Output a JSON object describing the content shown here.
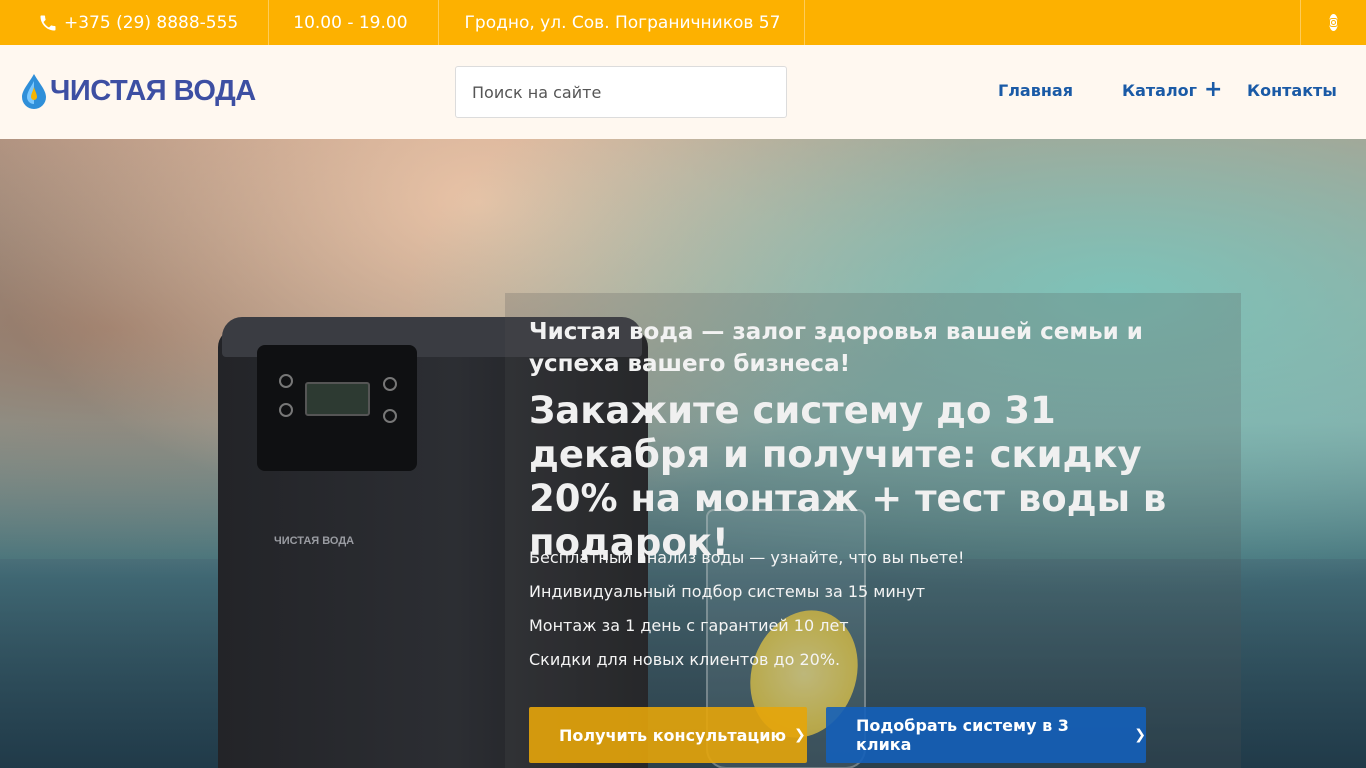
{
  "topbar": {
    "phone": "+375 (29) 8888-555",
    "hours": "10.00 - 19.00",
    "address": "Гродно, ул. Сов. Пограничников 57",
    "social_icon": "instagram-icon"
  },
  "header": {
    "logo_text": "ЧИСТАЯ ВОДА",
    "search_placeholder": "Поиск на сайте",
    "nav": {
      "home": "Главная",
      "catalog": "Каталог",
      "catalog_expand": "+",
      "contacts": "Контакты"
    }
  },
  "hero": {
    "subtitle": "Чистая вода — залог здоровья вашей семьи и успеха вашего бизнеса!",
    "title": "Закажите систему до 31 декабря и получите: скидку 20% на монтаж + тест воды в подарок!",
    "benefits": [
      "Бесплатный анализ воды — узнайте, что вы пьете!",
      "Индивидуальный подбор системы за 15 минут",
      "Монтаж за 1 день с гарантией 10 лет",
      "Скидки для новых клиентов до 20%."
    ],
    "device_brand": "ЧИСТАЯ ВОДА",
    "buttons": {
      "consult": "Получить консультацию",
      "pick": "Подобрать систему в 3 клика"
    }
  },
  "colors": {
    "topbar": "#fdb100",
    "brand_blue": "#3d4fa3",
    "nav_blue": "#1a5aa6"
  }
}
